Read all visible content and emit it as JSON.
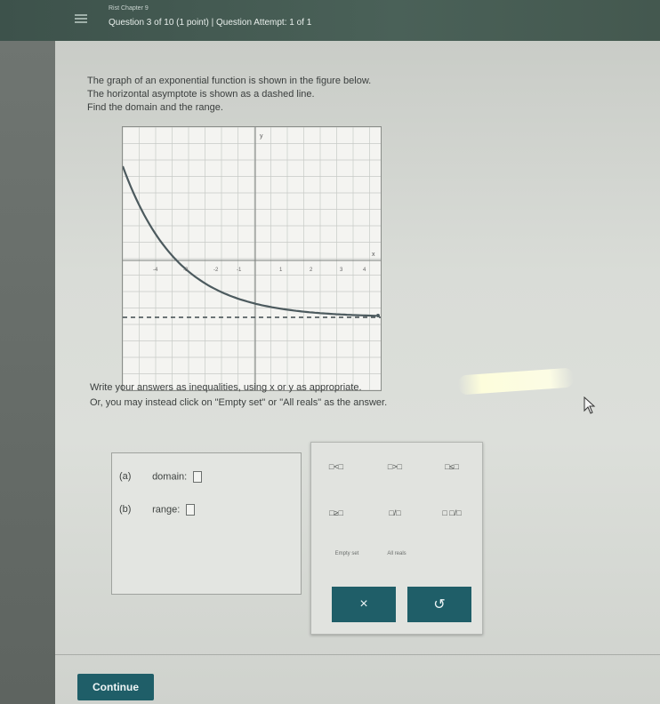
{
  "header": {
    "section": "Rist Chapter 9",
    "question_info": "Question 3 of 10 (1 point)  |  Question Attempt: 1 of 1"
  },
  "problem": {
    "line1": "The graph of an exponential function is shown in the figure below.",
    "line2": "The horizontal asymptote is shown as a dashed line.",
    "line3": "Find the domain and the range."
  },
  "graph": {
    "y_axis_label": "y",
    "x_axis_label": "x",
    "tick_labels": [
      "-4",
      "-3",
      "-2",
      "-1",
      "1",
      "2",
      "3",
      "4"
    ],
    "curve_color": "#4c5a5e",
    "asymptote_color": "#3e4a4e"
  },
  "instructions": {
    "line1": "Write your answers as inequalities, using x or y as appropriate.",
    "line2": "Or, you may instead click on \"Empty set\" or \"All reals\" as the answer."
  },
  "answers": {
    "domain_letter": "(a)",
    "domain_label": "domain:",
    "range_letter": "(b)",
    "range_label": "range:"
  },
  "keypad": {
    "lt": "□<□",
    "gt": "□>□",
    "le": "□≤□",
    "ge": "□≥□",
    "frac": "□/□",
    "mixed": "□ □/□",
    "empty_set": "Empty set",
    "all_reals": "All reals",
    "clear_symbol": "×",
    "undo_symbol": "↺"
  },
  "footer": {
    "continue_label": "Continue"
  },
  "colors": {
    "accent": "#1f5e68",
    "header": "#4a6158"
  }
}
